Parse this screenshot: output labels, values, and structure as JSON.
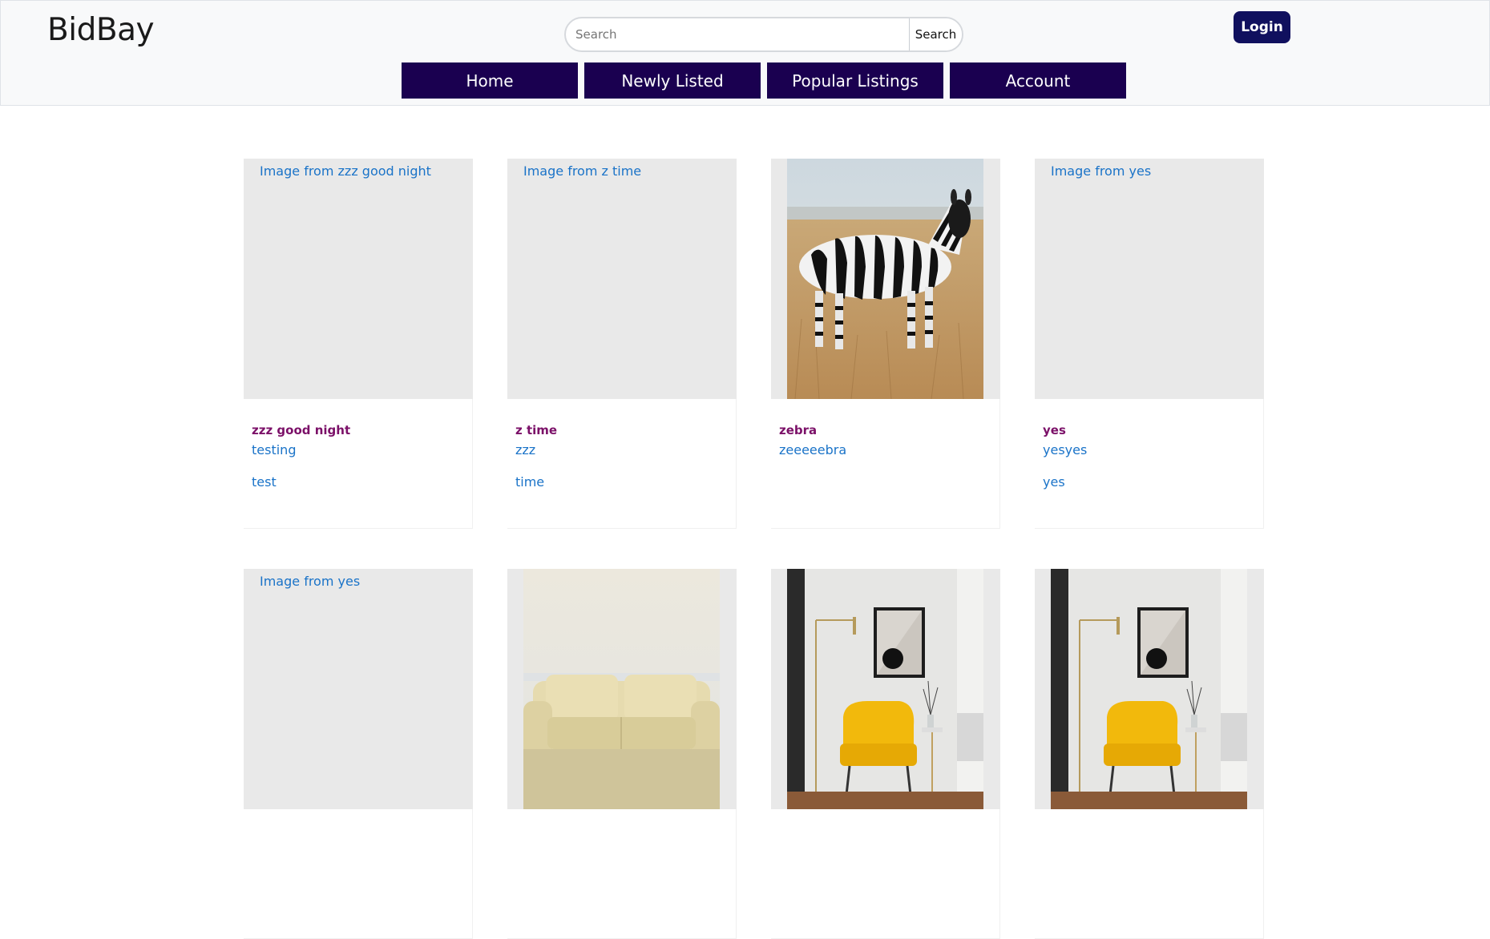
{
  "header": {
    "brand": "BidBay",
    "search": {
      "placeholder": "Search",
      "button_label": "Search"
    },
    "login_label": "Login"
  },
  "nav": [
    {
      "label": "Home"
    },
    {
      "label": "Newly Listed"
    },
    {
      "label": "Popular Listings"
    },
    {
      "label": "Account"
    }
  ],
  "listings": [
    {
      "alt": "Image from zzz good night",
      "title": "zzz good night",
      "desc": "testing",
      "extra": "test"
    },
    {
      "alt": "Image from z time",
      "title": "z time",
      "desc": "zzz",
      "extra": "time"
    },
    {
      "alt": "",
      "title": "zebra",
      "desc": "zeeeeebra",
      "extra": "",
      "image": "zebra"
    },
    {
      "alt": "Image from yes",
      "title": "yes",
      "desc": "yesyes",
      "extra": "yes"
    },
    {
      "alt": "Image from yes",
      "title": "",
      "desc": "",
      "extra": ""
    },
    {
      "alt": "",
      "title": "",
      "desc": "",
      "extra": "",
      "image": "sofa"
    },
    {
      "alt": "",
      "title": "",
      "desc": "",
      "extra": "",
      "image": "yellow-chair-room"
    },
    {
      "alt": "",
      "title": "",
      "desc": "",
      "extra": "",
      "image": "yellow-chair-room"
    }
  ]
}
